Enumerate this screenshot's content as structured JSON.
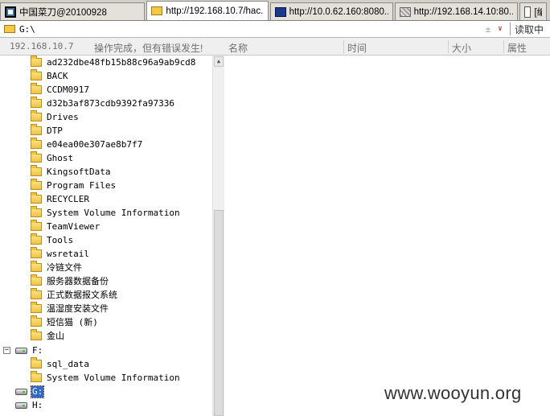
{
  "tabs": [
    {
      "label": "中国菜刀@20100928",
      "icon": "app-icon",
      "active": false
    },
    {
      "label": "http://192.168.10.7/hac...",
      "icon": "folder-icon",
      "active": true
    },
    {
      "label": "http://10.0.62.160:8080...",
      "icon": "document-icon",
      "active": false
    },
    {
      "label": "http://192.168.14.10:80...",
      "icon": "network-icon",
      "active": false
    },
    {
      "label": "[编",
      "icon": "page-icon",
      "active": false
    }
  ],
  "address": {
    "path": "G:\\",
    "dropdown_glyph": "±",
    "chevron": "∨",
    "read_label": "读取中"
  },
  "header": {
    "ip": "192.168.10.7",
    "status": "操作完成，但有错误发生!",
    "columns": [
      "名称",
      "时间",
      "大小",
      "属性"
    ]
  },
  "tree": {
    "g_folders": [
      "ad232dbe48fb15b88c96a9ab9cd8",
      "BACK",
      "CCDM0917",
      "d32b3af873cdb9392fa97336",
      "Drives",
      "DTP",
      "e04ea00e307ae8b7f7",
      "Ghost",
      "KingsoftData",
      "Program Files",
      "RECYCLER",
      "System Volume Information",
      "TeamViewer",
      "Tools",
      "wsretail",
      "冷链文件",
      "服务器数据备份",
      "正式数据报文系统",
      "温湿度安装文件",
      "短信猫 (新)",
      "金山"
    ],
    "drive_f": {
      "label": "F:",
      "expander": "−",
      "children": [
        "sql_data",
        "System Volume Information"
      ]
    },
    "drive_g": {
      "label": "G:"
    },
    "drive_h": {
      "label": "H:"
    }
  },
  "scroll": {
    "up_glyph": "▲"
  },
  "watermark": "www.wooyun.org"
}
